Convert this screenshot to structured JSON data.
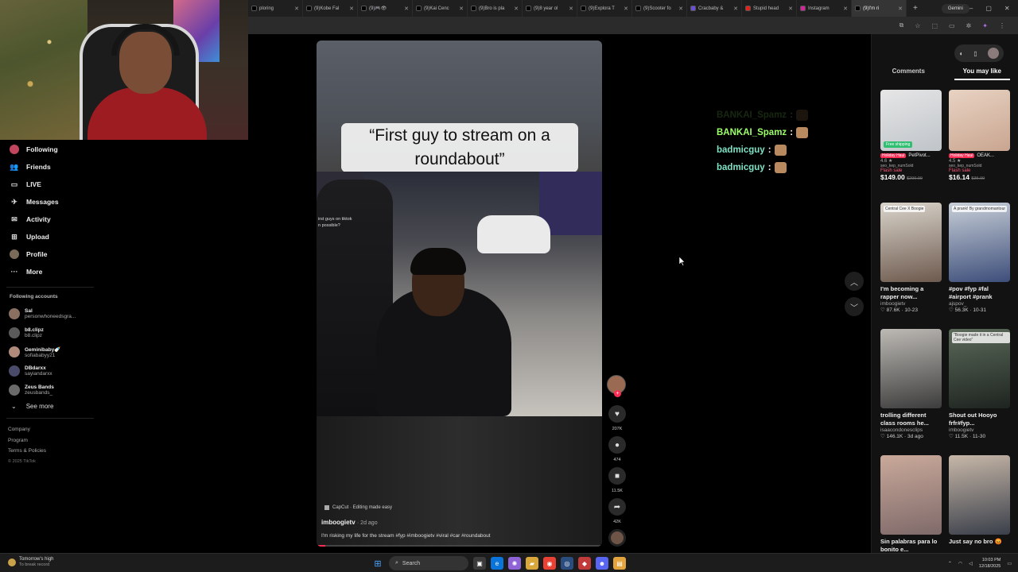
{
  "browser": {
    "tabs": [
      {
        "label": "ploring",
        "icon_color": "#000000"
      },
      {
        "label": "(9)Kobe Fal",
        "icon_color": "#000000"
      },
      {
        "label": "(9)🎮👁",
        "icon_color": "#000000"
      },
      {
        "label": "(9)Kai Cenc",
        "icon_color": "#000000"
      },
      {
        "label": "(9)Bro is pla",
        "icon_color": "#000000"
      },
      {
        "label": "(9)8 year ol",
        "icon_color": "#000000"
      },
      {
        "label": "(9)Explora T",
        "icon_color": "#000000"
      },
      {
        "label": "(9)Scooter fo",
        "icon_color": "#000000"
      },
      {
        "label": "Cracbaby &",
        "icon_color": "#6a4fd8"
      },
      {
        "label": "Stupid head",
        "icon_color": "#e62117"
      },
      {
        "label": "Instagram",
        "icon_color": "#d6249f"
      },
      {
        "label": "(9)I'm ri",
        "icon_color": "#000000",
        "active": true
      }
    ],
    "new_tab": "+",
    "gemini_label": "Gemini",
    "window_controls": [
      "–",
      "▢",
      "✕"
    ]
  },
  "sidebar": {
    "nav": [
      {
        "label": "Following",
        "icon": "following-avatar-icon"
      },
      {
        "label": "Friends",
        "icon": "friends-icon"
      },
      {
        "label": "LIVE",
        "icon": "live-icon"
      },
      {
        "label": "Messages",
        "icon": "messages-icon"
      },
      {
        "label": "Activity",
        "icon": "activity-icon"
      },
      {
        "label": "Upload",
        "icon": "upload-icon"
      },
      {
        "label": "Profile",
        "icon": "profile-icon"
      },
      {
        "label": "More",
        "icon": "more-icon"
      }
    ],
    "following_accounts_label": "Following accounts",
    "accounts": [
      {
        "name": "Sal",
        "handle": "personwhoneedsgra..."
      },
      {
        "name": "b8.clipz",
        "handle": "b8.clipz"
      },
      {
        "name": "Geminibaby🍼",
        "handle": "sofiababyy21"
      },
      {
        "name": "DBdarxx",
        "handle": "sayiandarxx"
      },
      {
        "name": "Zeus Bands",
        "handle": "zeusbands_"
      }
    ],
    "see_more": "See more",
    "footer_links": [
      "Company",
      "Program",
      "Terms & Policies"
    ],
    "copyright": "© 2025 TikTok"
  },
  "video": {
    "caption": "“First guy to stream on a roundabout”",
    "overlay_text": "irst guys on tiktok\nn possible?",
    "capcut_label": "CapCut · Editing made easy",
    "author": "imboogietv",
    "posted": "· 2d ago",
    "description": "I'm risking my life for the stream #fyp #imboogietv #viral #car #roundabout",
    "progress": 0.03
  },
  "actions": {
    "likes": "207K",
    "comments": "474",
    "saves": "11.5K",
    "shares": "42K"
  },
  "chat": [
    {
      "user": "BANKAI_Spamz",
      "faded": true,
      "color": "#9dff6a"
    },
    {
      "user": "BANKAI_Spamz",
      "faded": false,
      "color": "#9dff6a"
    },
    {
      "user": "badmicguy",
      "faded": false,
      "color": "#7fe3c6"
    },
    {
      "user": "badmicguy",
      "faded": false,
      "color": "#7fe3c6"
    }
  ],
  "right_panel": {
    "tabs": [
      "Comments",
      "You may like"
    ],
    "active_tab": "You may like",
    "shop_items": [
      {
        "tag": "Holiday Haul",
        "name": "PetPivot...",
        "rating": "4.6 ★",
        "seller": "seo_kep_numSold",
        "flash": "Flash sale",
        "price": "$149.00",
        "old_price": "$299.99",
        "thumb_label": "",
        "badge": "Free shipping"
      },
      {
        "tag": "Holiday Haul",
        "name": "OEAK...",
        "rating": "4.5 ★",
        "seller": "seo_kep_numSold",
        "flash": "Flash sale",
        "price": "$16.14",
        "old_price": "$35.99",
        "thumb_label": "",
        "badge": ""
      }
    ],
    "videos": [
      {
        "title": "I'm becoming a rapper now...",
        "author": "imboogietv",
        "meta": "♡ 87.6K · 10-23",
        "thumb_label": "Central Cee X Boogie",
        "colors": [
          "#d9d4cb",
          "#6e5a4e"
        ]
      },
      {
        "title": "#pov #fyp #fal #airport #prank",
        "author": "ajspov_",
        "meta": "♡ 56.3K · 10-31",
        "thumb_label": "A prank! By grandmomantour",
        "colors": [
          "#c8cfd8",
          "#3d4e7a"
        ]
      },
      {
        "title": "trolling different class rooms he...",
        "author": "isaacondonesclips",
        "meta": "♡ 146.1K · 3d ago",
        "thumb_label": "",
        "colors": [
          "#bdbab5",
          "#3c3c3c"
        ]
      },
      {
        "title": "Shout out Hooyo frfr#fyp...",
        "author": "imboogietv",
        "meta": "♡ 11.5K · 11-30",
        "thumb_label": "\"Boogie made it in a Central Cee video\"",
        "colors": [
          "#5b6a5a",
          "#1e2420"
        ]
      },
      {
        "title": "Sin palabras para lo bonito e...",
        "author": "",
        "meta": "",
        "thumb_label": "",
        "colors": [
          "#c9a99a",
          "#7f6a6a"
        ]
      },
      {
        "title": "Just say no bro 😡",
        "author": "",
        "meta": "",
        "thumb_label": "",
        "colors": [
          "#c7b7a8",
          "#3a3f4a"
        ]
      }
    ]
  },
  "taskbar": {
    "weather_line1": "Tomorrow's high",
    "weather_line2": "To break record",
    "search_placeholder": "Search",
    "time": "10:03 PM",
    "date": "12/18/2025"
  }
}
